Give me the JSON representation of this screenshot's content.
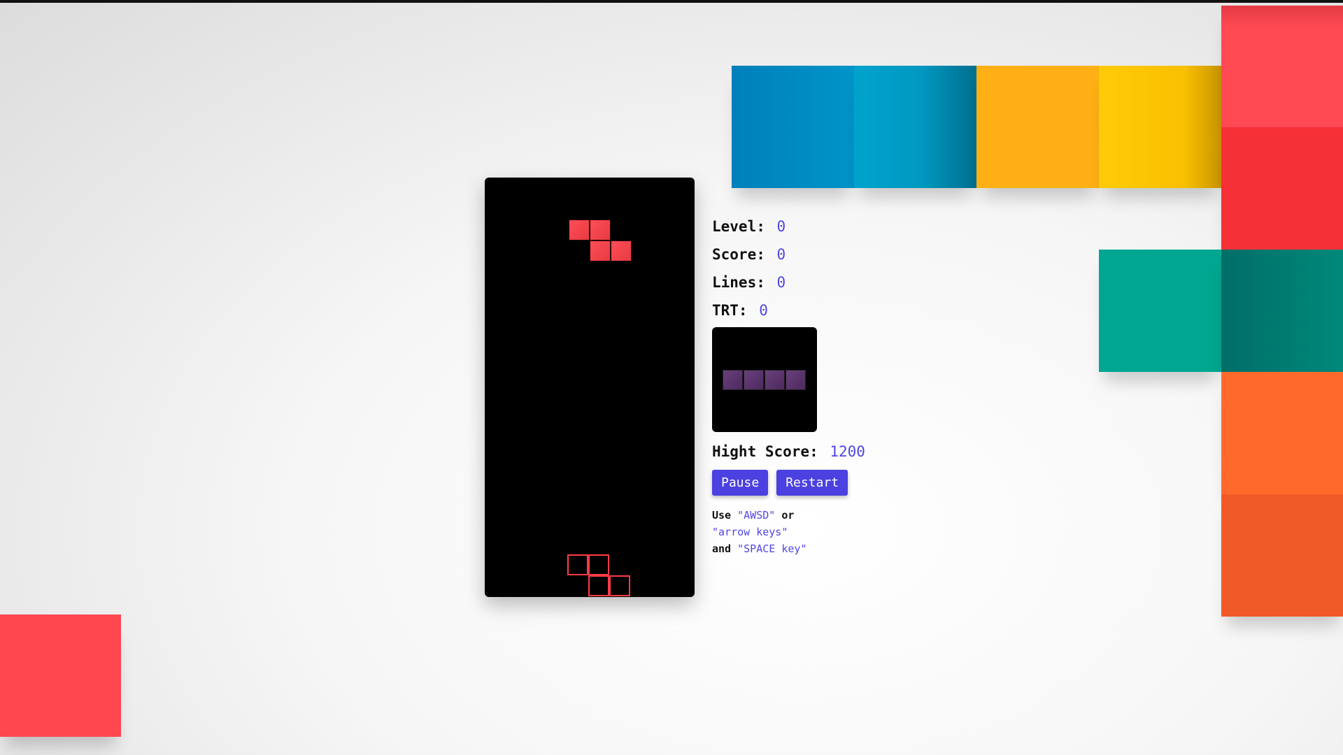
{
  "stats": {
    "level_label": "Level:",
    "level": "0",
    "score_label": "Score:",
    "score": "0",
    "lines_label": "Lines:",
    "lines": "0",
    "trt_label": "TRT:",
    "trt": "0",
    "high_label": "Hight Score:",
    "high": "1200"
  },
  "buttons": {
    "pause": "Pause",
    "restart": "Restart"
  },
  "help": {
    "use": "Use",
    "awsd": "\"AWSD\"",
    "or": "or",
    "arrows": "\"arrow keys\"",
    "and": "and",
    "space": "\"SPACE key\""
  },
  "pieces": {
    "active": "Z",
    "active_color": "#ff4d57",
    "next": "I",
    "next_color": "#5a3570"
  },
  "decor_colors": [
    "#0089c0",
    "#00a0c8",
    "#ffb013",
    "#ffcb05",
    "#ff4750",
    "#00a68f",
    "#ff6a2c",
    "#f05a28"
  ]
}
